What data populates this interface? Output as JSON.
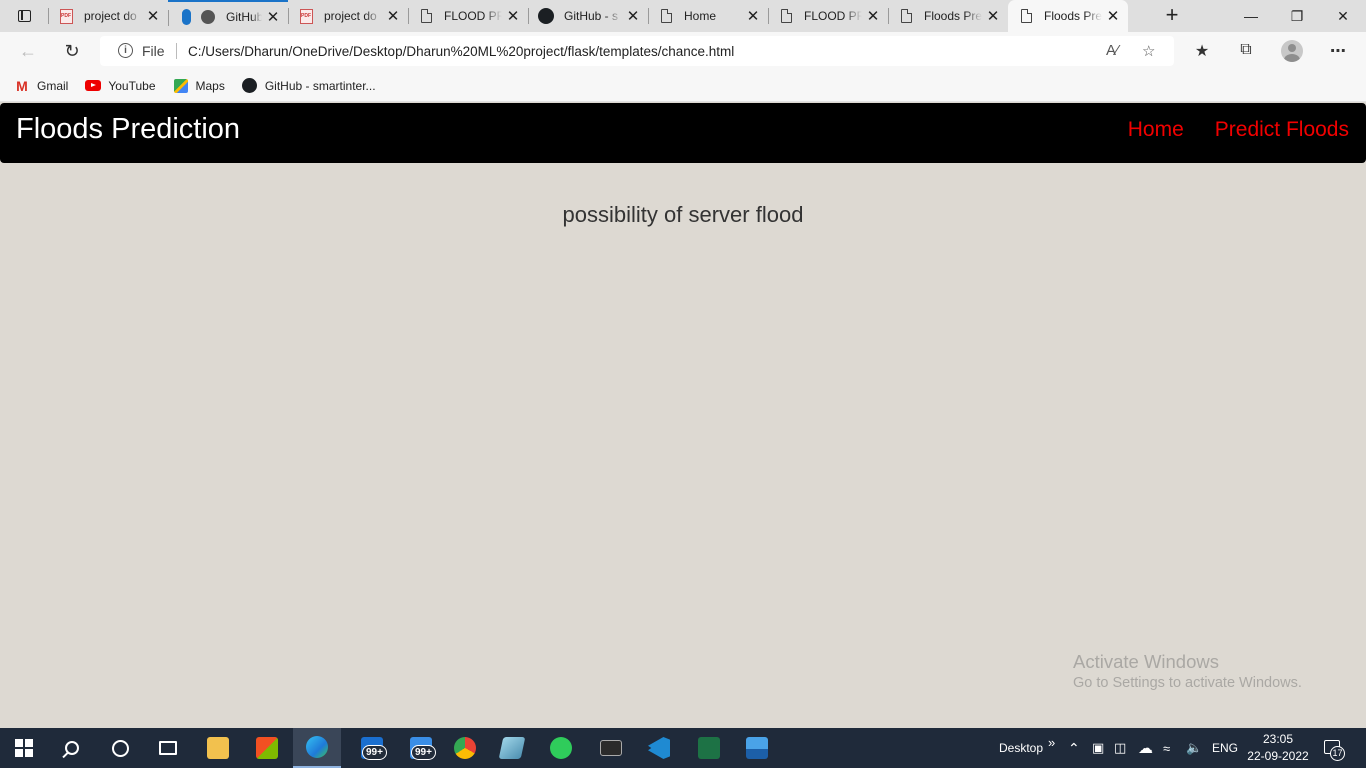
{
  "browser": {
    "tabs": [
      {
        "title": "project do",
        "icon": "pdf-icon",
        "close": "✕"
      },
      {
        "title": "GitHub - s",
        "icon": "github-icon",
        "close": "✕",
        "loading": true
      },
      {
        "title": "project do",
        "icon": "pdf-icon",
        "close": "✕"
      },
      {
        "title": "FLOOD PR",
        "icon": "page-icon",
        "close": "✕"
      },
      {
        "title": "GitHub - s",
        "icon": "github-icon",
        "close": "✕"
      },
      {
        "title": "Home",
        "icon": "page-icon",
        "close": "✕"
      },
      {
        "title": "FLOOD PR",
        "icon": "page-icon",
        "close": "✕"
      },
      {
        "title": "Floods Pre",
        "icon": "page-icon",
        "close": "✕"
      },
      {
        "title": "Floods Pre",
        "icon": "page-icon",
        "close": "✕",
        "active": true
      }
    ],
    "new_tab": "+",
    "address": {
      "info": "i",
      "scheme_label": "File",
      "url": "C:/Users/Dharun/OneDrive/Desktop/Dharun%20ML%20project/flask/templates/chance.html"
    },
    "bookmarks": [
      {
        "label": "Gmail",
        "icon": "gmail-icon"
      },
      {
        "label": "YouTube",
        "icon": "youtube-icon"
      },
      {
        "label": "Maps",
        "icon": "maps-icon"
      },
      {
        "label": "GitHub - smartinter...",
        "icon": "github-icon"
      }
    ]
  },
  "site": {
    "brand": "Floods Prediction",
    "nav": [
      "Home",
      "Predict Floods"
    ],
    "message": "possibility of server flood",
    "colors": {
      "navbar": "#000000",
      "nav_link": "#f10000",
      "background": "#ddd9d2"
    }
  },
  "watermark": {
    "line1": "Activate Windows",
    "line2": "Go to Settings to activate Windows."
  },
  "taskbar": {
    "mail_badge": "99+",
    "chat_badge": "99+",
    "desktop_label": "Desktop",
    "chevron": "»",
    "language": "ENG",
    "time": "23:05",
    "date": "22-09-2022",
    "notification_count": "17"
  }
}
